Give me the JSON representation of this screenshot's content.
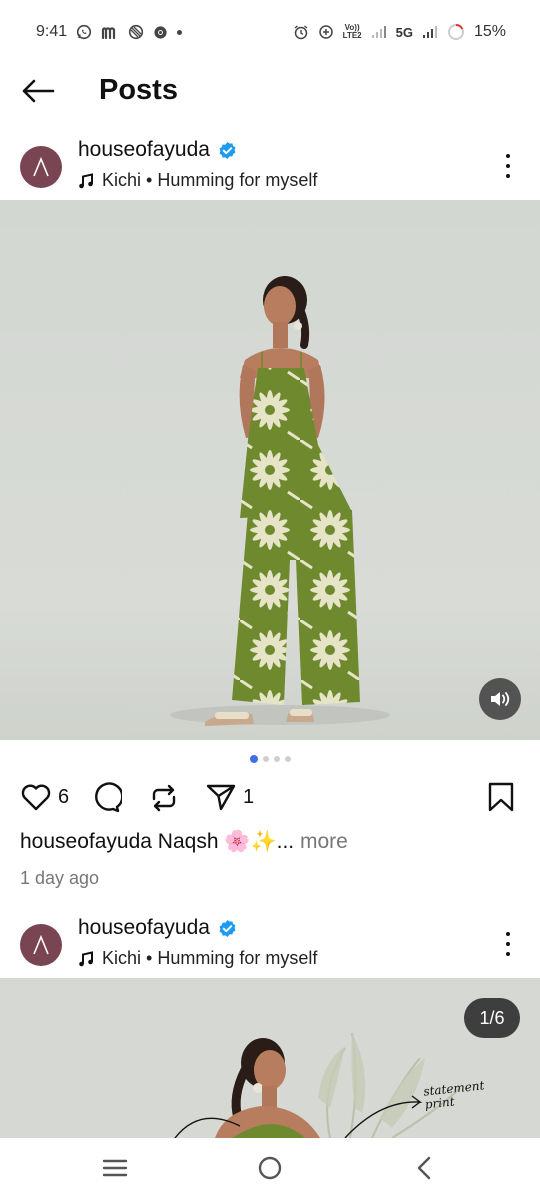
{
  "status_bar": {
    "time": "9:41",
    "network": "5G",
    "volte_top": "Vo))",
    "volte_bottom": "LTE2",
    "battery": "15%"
  },
  "header": {
    "title": "Posts"
  },
  "posts": [
    {
      "username": "houseofayuda",
      "verified": true,
      "music": "Kichi • Humming for myself",
      "likes": "6",
      "shares": "1",
      "caption_user": "houseofayuda",
      "caption_text": "Naqsh 🌸✨...",
      "caption_more": " more",
      "time_ago": "1 day ago",
      "carousel_pages": 4,
      "carousel_active": 1
    },
    {
      "username": "houseofayuda",
      "verified": true,
      "music": "Kichi • Humming for myself",
      "media_counter": "1/6",
      "annotation": "statement print"
    }
  ],
  "colors": {
    "accent_blue": "#3f6fe8",
    "verified_blue": "#1d9bf0",
    "avatar_bg": "#7a4552",
    "outfit_green": "#6f8a2e",
    "media_bg": "#d6d9d4"
  },
  "icons": {
    "back": "arrow-left-icon",
    "more": "more-vertical-icon",
    "like": "heart-icon",
    "comment": "comment-icon",
    "repost": "repost-icon",
    "share": "send-icon",
    "save": "bookmark-icon",
    "sound": "speaker-icon",
    "music": "music-note-icon",
    "nav_menu": "menu-icon",
    "nav_home": "home-circle-icon",
    "nav_back": "chevron-left-icon"
  }
}
